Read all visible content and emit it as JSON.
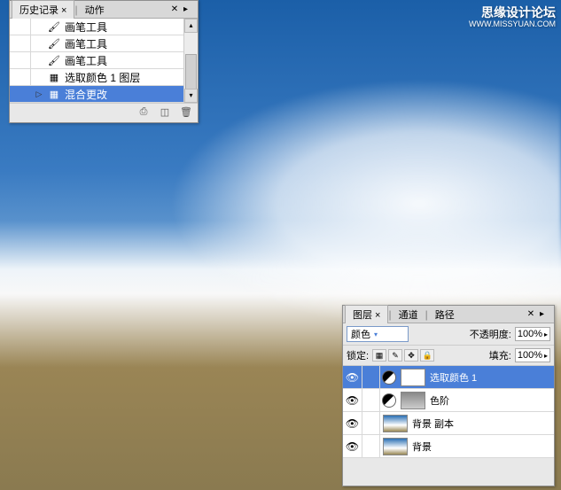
{
  "watermark": "思缘设计论坛",
  "watermark_sub": "WWW.MISSYUAN.COM",
  "history": {
    "tabs": [
      "历史记录",
      "动作"
    ],
    "active_tab": 0,
    "items": [
      {
        "icon": "brush",
        "label": "画笔工具",
        "selected": false
      },
      {
        "icon": "brush",
        "label": "画笔工具",
        "selected": false
      },
      {
        "icon": "brush",
        "label": "画笔工具",
        "selected": false
      },
      {
        "icon": "adjust",
        "label": "选取颜色 1 图层",
        "selected": false
      },
      {
        "icon": "adjust",
        "label": "混合更改",
        "selected": true
      }
    ]
  },
  "layers": {
    "tabs": [
      "图层",
      "通道",
      "路径"
    ],
    "active_tab": 0,
    "blend_mode": "颜色",
    "opacity_label": "不透明度:",
    "opacity_value": "100%",
    "lock_label": "锁定:",
    "fill_label": "填充:",
    "fill_value": "100%",
    "items": [
      {
        "visible": true,
        "thumb": "white",
        "adj": true,
        "name": "选取颜色 1",
        "selected": true
      },
      {
        "visible": true,
        "thumb": "gray",
        "adj": true,
        "name": "色阶",
        "selected": false
      },
      {
        "visible": true,
        "thumb": "photo",
        "adj": false,
        "name": "背景 副本",
        "selected": false
      },
      {
        "visible": true,
        "thumb": "photo",
        "adj": false,
        "name": "背景",
        "selected": false
      }
    ]
  }
}
